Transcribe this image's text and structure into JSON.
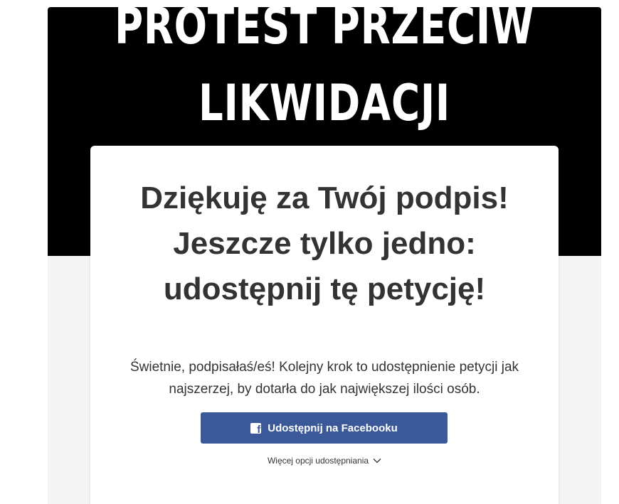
{
  "hero": {
    "line1": "PROTEST PRZECIW",
    "line2": "LIKWIDACJI"
  },
  "modal": {
    "title": "Dziękuję za Twój podpis! Jeszcze tylko jedno: udostępnij tę petycję!",
    "description": "Świetnie, podpisałaś/eś! Kolejny krok to udostępnienie petycji jak najszerzej, by dotarła do jak największej ilości osób.",
    "facebook_button": "Udostępnij na Facebooku",
    "facebook_icon": "facebook-icon",
    "more_options": "Więcej opcji udostępniania",
    "more_options_icon": "chevron-down-icon"
  },
  "colors": {
    "facebook_blue": "#3b5998",
    "text": "#333333",
    "hero_bg": "#000000",
    "page_bg": "#f4f4f4"
  }
}
